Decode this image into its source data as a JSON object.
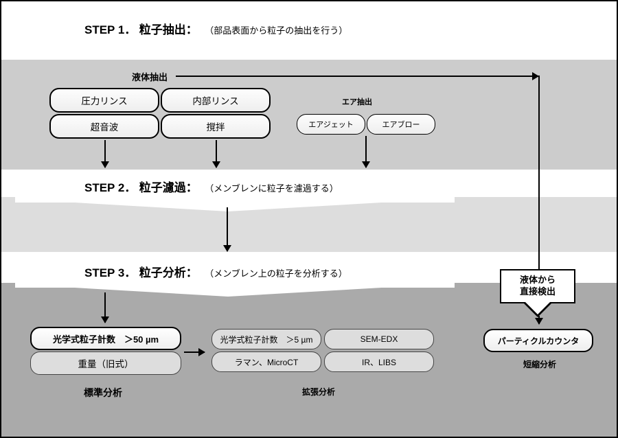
{
  "steps": {
    "s1": {
      "num": "STEP 1．",
      "title": "粒子抽出：",
      "detail": "（部品表面から粒子の抽出を行う）"
    },
    "s2": {
      "num": "STEP 2．",
      "title": "粒子濾過：",
      "detail": "（メンブレンに粒子を濾過する）"
    },
    "s3": {
      "num": "STEP 3．",
      "title": "粒子分析：",
      "detail": "（メンブレン上の粒子を分析する）"
    }
  },
  "labels": {
    "liquid_extraction": "液体抽出",
    "air_extraction": "エア抽出",
    "callout_line1": "液体から",
    "callout_line2": "直接検出",
    "standard_analysis": "標準分析",
    "extended_analysis": "拡張分析",
    "short_analysis": "短縮分析"
  },
  "liquid_methods": {
    "a": "圧力リンス",
    "b": "内部リンス",
    "c": "超音波",
    "d": "撹拌"
  },
  "air_methods": {
    "a": "エアジェット",
    "b": "エアブロー"
  },
  "analysis_standard": {
    "a": "光学式粒子計数　＞50 µm",
    "b": "重量（旧式）"
  },
  "analysis_extended": {
    "a": "光学式粒子計数　＞5 µm",
    "b": "ラマン、MicroCT",
    "c": "SEM-EDX",
    "d": "IR、LIBS"
  },
  "analysis_short": {
    "a": "パーティクルカウンタ"
  }
}
